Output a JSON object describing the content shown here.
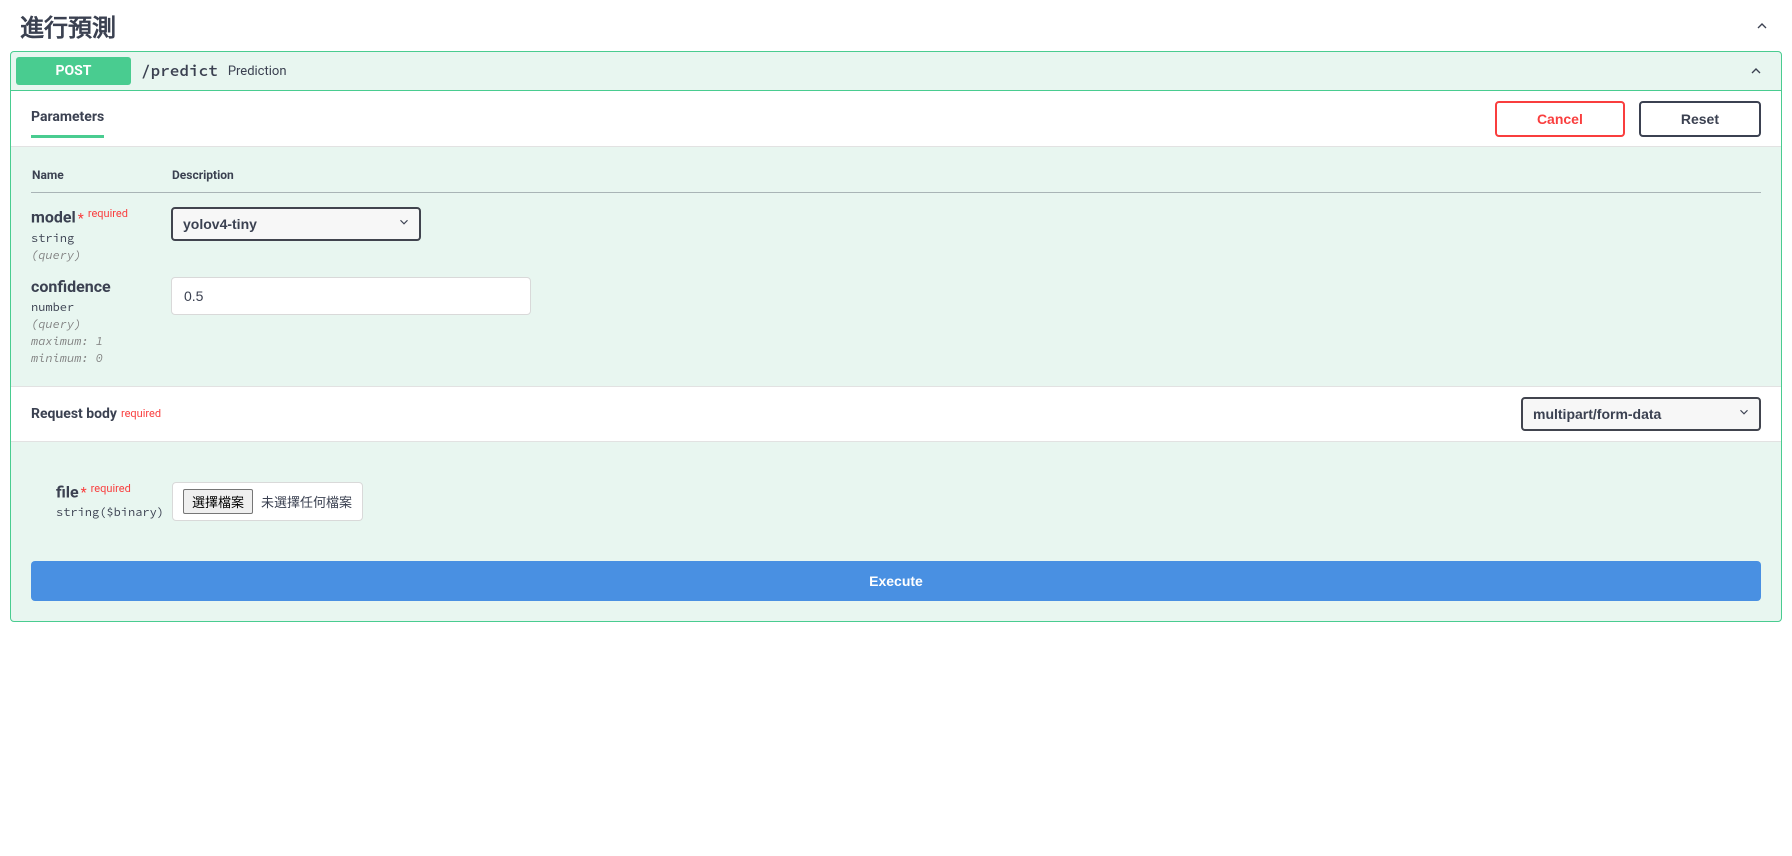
{
  "section": {
    "title": "進行預測"
  },
  "operation": {
    "method": "POST",
    "path": "/predict",
    "summary": "Prediction"
  },
  "tabs": {
    "parameters": "Parameters"
  },
  "buttons": {
    "cancel": "Cancel",
    "reset": "Reset",
    "execute": "Execute",
    "choose_file": "選擇檔案",
    "no_file": "未選擇任何檔案"
  },
  "params_header": {
    "name": "Name",
    "description": "Description"
  },
  "labels": {
    "required": "required"
  },
  "params": {
    "model": {
      "name": "model",
      "type": "string",
      "loc": "(query)",
      "value": "yolov4-tiny"
    },
    "confidence": {
      "name": "confidence",
      "type": "number",
      "loc": "(query)",
      "max": "maximum: 1",
      "min": "minimum: 0",
      "value": "0.5"
    }
  },
  "request_body": {
    "title": "Request body",
    "content_type": "multipart/form-data",
    "file": {
      "name": "file",
      "type": "string($binary)"
    }
  }
}
